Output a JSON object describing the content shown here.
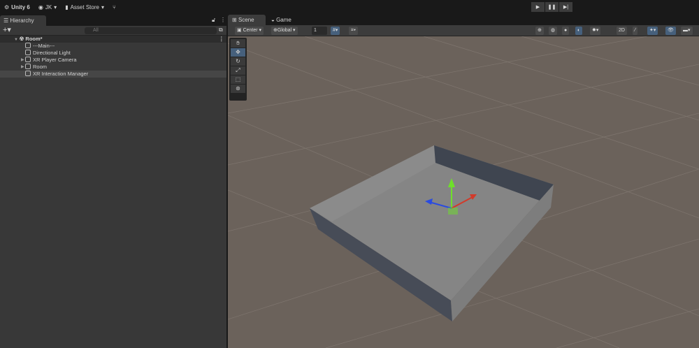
{
  "topbar": {
    "app": "Unity 6",
    "account": "JK",
    "asset_store": "Asset Store"
  },
  "playbar": {
    "play": "▶",
    "pause": "❚❚",
    "step": "▶|"
  },
  "hierarchy": {
    "tab": "Hierarchy",
    "search_placeholder": "All",
    "scene": "Room*",
    "items": [
      {
        "label": "---Main---",
        "expandable": false
      },
      {
        "label": "Directional Light",
        "expandable": false
      },
      {
        "label": "XR Player Camera",
        "expandable": true
      },
      {
        "label": "Room",
        "expandable": true
      },
      {
        "label": "XR Interaction Manager",
        "expandable": false,
        "selected": true
      }
    ]
  },
  "scene_tabs": {
    "scene": "Scene",
    "game": "Game"
  },
  "scene_toolbar": {
    "pivot": "Center",
    "space": "Global",
    "grid_snap": "1"
  },
  "colors": {
    "accent": "#46607c",
    "floor": "#6b625b",
    "x_axis": "#d23a2a",
    "y_axis": "#6ee02a",
    "z_axis": "#2a4be0"
  }
}
